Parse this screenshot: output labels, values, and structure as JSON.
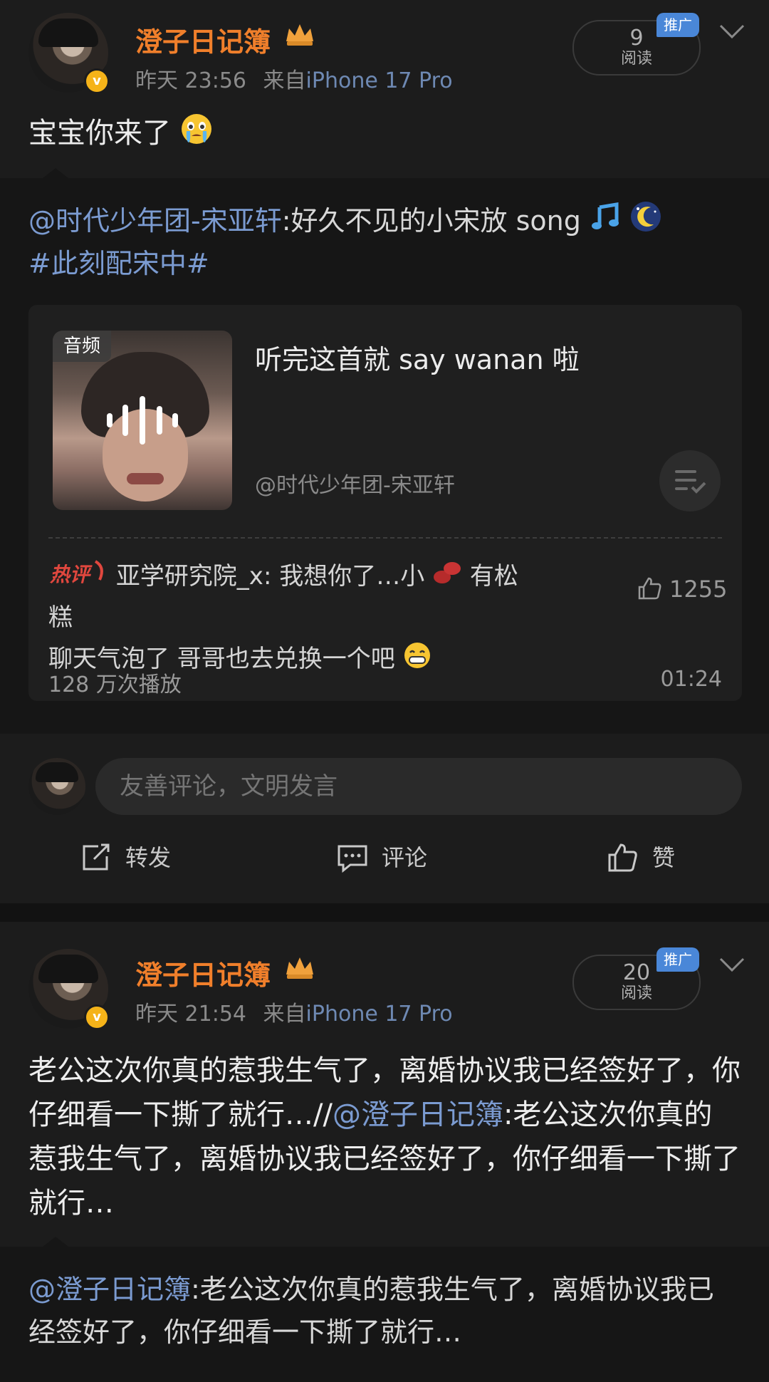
{
  "posts": [
    {
      "username": "澄子日记簿",
      "time": "昨天 23:56",
      "source_prefix": "来自",
      "source": "iPhone 17 Pro",
      "read_count": "9",
      "read_label": "阅读",
      "promo_label": "推广",
      "content": "宝宝你来了",
      "repost": {
        "mention": "@时代少年团-宋亚轩",
        "text": ":好久不见的小宋放 song",
        "hashtag": "#此刻配宋中#"
      },
      "audio_card": {
        "tag": "音频",
        "title": "听完这首就 say wanan 啦",
        "author": "@时代少年团-宋亚轩",
        "hot_comment_badge": "热评",
        "hot_comment_user": "亚学研究院_x",
        "hot_comment_text_1": ": 我想你了…小",
        "hot_comment_text_2": "有松糕",
        "hot_comment_text_3": "聊天气泡了 哥哥也去兑换一个吧",
        "likes": "1255",
        "plays": "128 万次播放",
        "duration": "01:24"
      },
      "comment_placeholder": "友善评论，文明发言",
      "actions": {
        "repost": "转发",
        "comment": "评论",
        "like": "赞"
      }
    },
    {
      "username": "澄子日记簿",
      "time": "昨天 21:54",
      "source_prefix": "来自",
      "source": "iPhone 17 Pro",
      "read_count": "20",
      "read_label": "阅读",
      "promo_label": "推广",
      "content_a": "老公这次你真的惹我生气了，离婚协议我已经签好了，你仔细看一下撕了就行…//",
      "content_mention": "@澄子日记簿",
      "content_b": ":老公这次你真的惹我生气了，离婚协议我已经签好了，你仔细看一下撕了就行…",
      "repost": {
        "mention": "@澄子日记簿",
        "text": ":老公这次你真的惹我生气了，离婚协议我已经签好了，你仔细看一下撕了就行…"
      }
    }
  ],
  "colors": {
    "accent_username": "#f07f2b",
    "link": "#7b9bd1",
    "promo": "#4a87d8",
    "vip_badge": "#f5b319"
  },
  "icons": [
    "crown-icon",
    "verified-badge-icon",
    "chevron-down-icon",
    "crying-emoji-icon",
    "music-note-emoji-icon",
    "moon-emoji-icon",
    "audio-wave-icon",
    "playlist-icon",
    "bean-emoji-icon",
    "grin-emoji-icon",
    "thumb-up-icon",
    "repost-icon",
    "comment-icon"
  ]
}
